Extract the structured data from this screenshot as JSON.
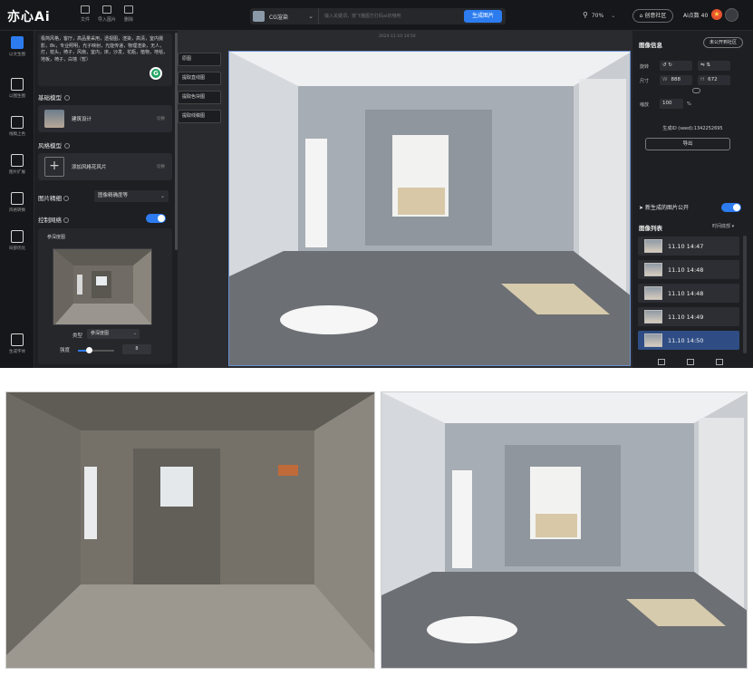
{
  "app": {
    "logo": "亦心Ai"
  },
  "topbar": {
    "buttons": [
      {
        "label": "文件"
      },
      {
        "label": "导入图片"
      },
      {
        "label": "删除"
      }
    ],
    "mode_label": "CG渲染",
    "prompt_placeholder": "输入关键词，按飞猫图方打码ai的哦吧",
    "generate_label": "生成图片",
    "zoom": "70%",
    "community_label": "创意社区",
    "points": "Ai点数 40"
  },
  "leftnav": {
    "items": [
      {
        "label": "以文生图"
      },
      {
        "label": "以图生图"
      },
      {
        "label": "线稿上色"
      },
      {
        "label": "图片扩展"
      },
      {
        "label": "风格转换"
      },
      {
        "label": "局部优化"
      },
      {
        "label": "生成字体"
      }
    ]
  },
  "panel": {
    "prompt_text": "极简风格，客厅，高品量采用，透视图，渲染，高清，室内摄影，8k，专业照明，光子映射，光能传递，物理渲染，无人，灯，枕头，椅子，风扇，室内，床，沙发，花瓶，植物，地毯，地板，椅子，白墙（暂）",
    "base_model_title": "基础模型",
    "base_model_name": "建筑设计",
    "switch_label": "切换",
    "style_model_title": "风格模型",
    "style_add_label": "添加风格花风片",
    "style_switch_label": "切换",
    "ratio_title": "图片精细",
    "ratio_value": "图像精确度等",
    "controlnet_title": "控制网络",
    "controlnet_sub": "参深度图",
    "type_label": "类型",
    "type_value": "参深度图",
    "strength_label": "强度",
    "strength_value": "8",
    "strength_fraction": 0.3
  },
  "canvas": {
    "timestamp": "2024-11-10 14:50",
    "tools": [
      {
        "label": "原图"
      },
      {
        "label": "提取直线图"
      },
      {
        "label": "提取色块图"
      },
      {
        "label": "提取线稿图"
      }
    ]
  },
  "rpanel": {
    "title": "图像信息",
    "unpublish_label": "未公开到社区",
    "rotate_label": "旋转",
    "size_label": "尺寸",
    "width_key": "W",
    "width_value": "888",
    "height_key": "H",
    "height_value": "672",
    "scale_label": "缩放",
    "scale_value": "100",
    "scale_unit": "%",
    "seed": "生成ID (seed):1342252695",
    "export_label": "导出",
    "publish_label": "新生成的图片公开",
    "list_title": "图像列表",
    "list_sort": "时间底部",
    "list": [
      {
        "time": "11.10 14:47"
      },
      {
        "time": "11.10 14:48"
      },
      {
        "time": "11.10 14:48"
      },
      {
        "time": "11.10 14:49"
      },
      {
        "time": "11.10 14:50"
      }
    ]
  },
  "colors": {
    "accent": "#2c7cf0",
    "bg": "#1c1d20",
    "selected_row": "#2f4d84"
  }
}
